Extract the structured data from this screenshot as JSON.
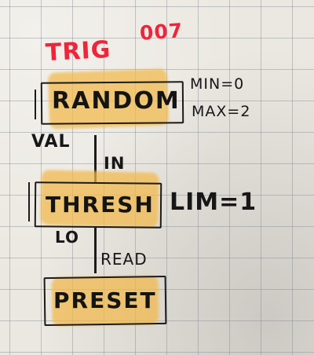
{
  "title": {
    "trig": "TRIG",
    "number": "007"
  },
  "nodes": [
    {
      "name": "RANDOM",
      "params": [
        "MIN=0",
        "MAX=2"
      ],
      "output": "VAL"
    },
    {
      "name": "THRESH",
      "input": "IN",
      "params": [
        "LIM=1"
      ],
      "output": "LO"
    },
    {
      "name": "PRESET",
      "input": "READ"
    }
  ],
  "colors": {
    "ink": "#1b1b1b",
    "red_marker": "#f0243a",
    "highlighter": "#f2b94a",
    "paper": "#ebe8e1",
    "grid": "#828c96"
  }
}
